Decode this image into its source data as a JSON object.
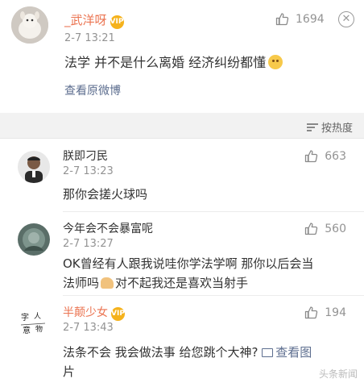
{
  "post": {
    "username": "_武洋呀",
    "badge": "VIP",
    "time": "2-7 13:21",
    "likes": "1694",
    "text": "法学 并不是什么离婚 经济纠纷都懂",
    "view_original": "查看原微博"
  },
  "sort": {
    "label": "按热度"
  },
  "comments": [
    {
      "username": "朕即刁民",
      "time": "2-7 13:23",
      "likes": "663",
      "text": "那你会搓火球吗"
    },
    {
      "username": "今年会不会暴富呢",
      "time": "2-7 13:27",
      "likes": "560",
      "text_line1": "OK曾经有人跟我说哇你学法学啊 那你以后会当",
      "text_line2": "法师吗",
      "text_line2b": "对不起我还是喜欢当射手"
    },
    {
      "username": "半颠少女",
      "badge": "VIP",
      "time": "2-7 13:43",
      "likes": "194",
      "text_line1": "法条不会 我会做法事 给您跳个大神?",
      "image_link": "查看图",
      "text_line2": "片"
    }
  ],
  "watermark": "头条新闻",
  "colors": {
    "accent": "#eb7350",
    "link": "#5d6e8f",
    "muted": "#939393"
  }
}
